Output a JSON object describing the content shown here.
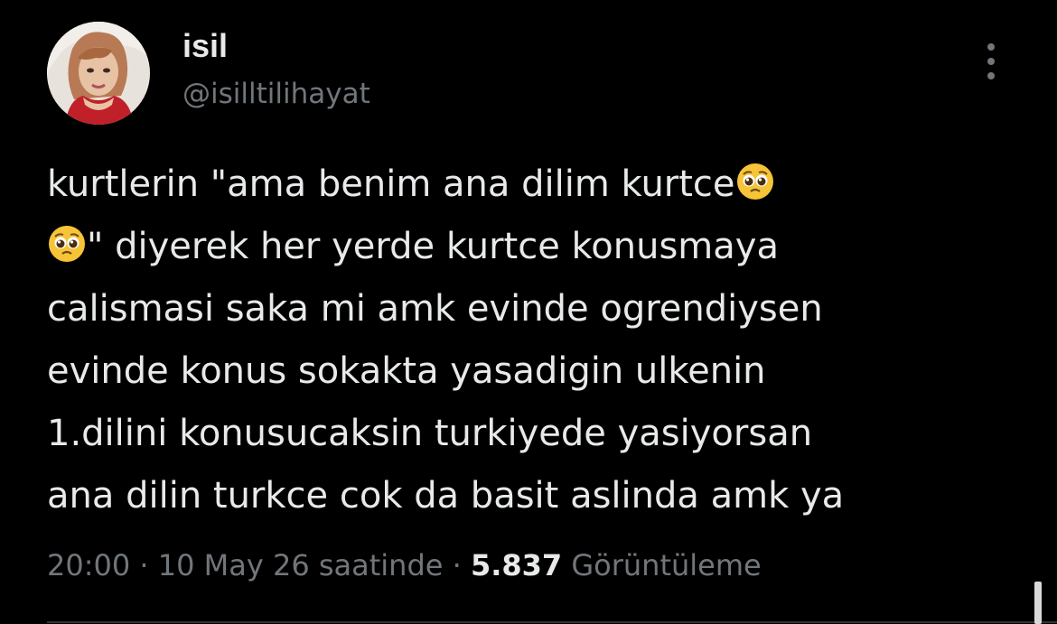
{
  "user": {
    "display_name": "isil",
    "handle": "@isilltilihayat",
    "avatar_icon": "profile-photo"
  },
  "tweet": {
    "lines": [
      {
        "parts": [
          {
            "text": "kurtlerin \"ama benim ana dilim kurtce"
          },
          {
            "emoji": "pleading-face-emoji"
          }
        ]
      },
      {
        "parts": [
          {
            "emoji": "pleading-face-emoji"
          },
          {
            "text": "\" diyerek her yerde kurtce konusmaya"
          }
        ]
      },
      {
        "parts": [
          {
            "text": "calismasi saka mi amk evinde ogrendiysen"
          }
        ]
      },
      {
        "parts": [
          {
            "text": "evinde konus sokakta yasadigin ulkenin"
          }
        ]
      },
      {
        "parts": [
          {
            "text": "1.dilini konusucaksin turkiyede yasiyorsan"
          }
        ]
      },
      {
        "parts": [
          {
            "text": "ana dilin turkce cok da basit aslinda amk ya"
          }
        ]
      }
    ]
  },
  "meta": {
    "time": "20:00",
    "separator": " · ",
    "date": "10 May 26 saatinde",
    "views_count": "5.837",
    "views_label": "Görüntüleme"
  },
  "icons": {
    "more": "more-options-icon",
    "emoji": "pleading-face-emoji"
  },
  "colors": {
    "background": "#000000",
    "primary_text": "#e7e9ea",
    "secondary_text": "#71767b",
    "emoji_face": "#f7c438"
  }
}
